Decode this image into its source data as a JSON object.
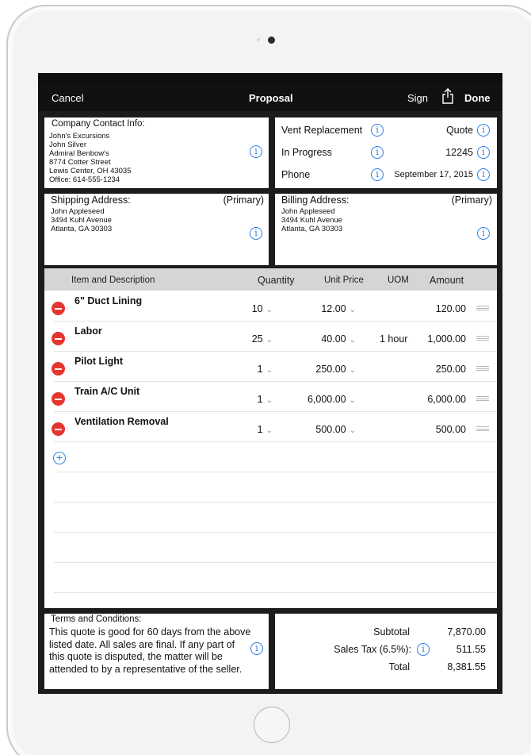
{
  "navbar": {
    "cancel": "Cancel",
    "title": "Proposal",
    "sign": "Sign",
    "done": "Done"
  },
  "contact": {
    "header": "Company Contact Info:",
    "lines": [
      "John's Excursions",
      "John Silver",
      "Admiral Benbow's",
      "8774 Cotter Street",
      "Lewis Center, OH  43035",
      "Office: 614-555-1234"
    ]
  },
  "status": {
    "rows": [
      {
        "label": "Vent Replacement",
        "value": "Quote"
      },
      {
        "label": "In Progress",
        "value": "12245"
      },
      {
        "label": "Phone",
        "value": "September 17, 2015"
      }
    ]
  },
  "shipping": {
    "title": "Shipping Address:",
    "tag": "(Primary)",
    "lines": [
      "John Appleseed",
      "3494 Kuhl Avenue",
      "Atlanta, GA  30303"
    ]
  },
  "billing": {
    "title": "Billing Address:",
    "tag": "(Primary)",
    "lines": [
      "John Appleseed",
      "3494 Kuhl Avenue",
      "Atlanta, GA  30303"
    ]
  },
  "items": {
    "columns": {
      "item": "Item and Description",
      "quantity": "Quantity",
      "unit_price": "Unit Price",
      "uom": "UOM",
      "amount": "Amount"
    },
    "rows": [
      {
        "name": "6\" Duct Lining",
        "qty": "10",
        "price": "12.00",
        "uom": "",
        "amount": "120.00"
      },
      {
        "name": "Labor",
        "qty": "25",
        "price": "40.00",
        "uom": "1 hour",
        "amount": "1,000.00"
      },
      {
        "name": "Pilot Light",
        "qty": "1",
        "price": "250.00",
        "uom": "",
        "amount": "250.00"
      },
      {
        "name": "Train A/C Unit",
        "qty": "1",
        "price": "6,000.00",
        "uom": "",
        "amount": "6,000.00"
      },
      {
        "name": "Ventilation Removal",
        "qty": "1",
        "price": "500.00",
        "uom": "",
        "amount": "500.00"
      }
    ]
  },
  "terms": {
    "header": "Terms and Conditions:",
    "body": "This quote is good for 60 days from the above listed date. All sales are final. If any part of this quote is disputed, the matter will be attended to by a representative of the seller."
  },
  "totals": {
    "subtotal_label": "Subtotal",
    "subtotal": "7,870.00",
    "tax_label": "Sales Tax (6.5%):",
    "tax": "511.55",
    "total_label": "Total",
    "total": "8,381.55"
  },
  "colors": {
    "accent": "#2b7de9",
    "delete": "#e5352f",
    "navbar": "#111111"
  }
}
